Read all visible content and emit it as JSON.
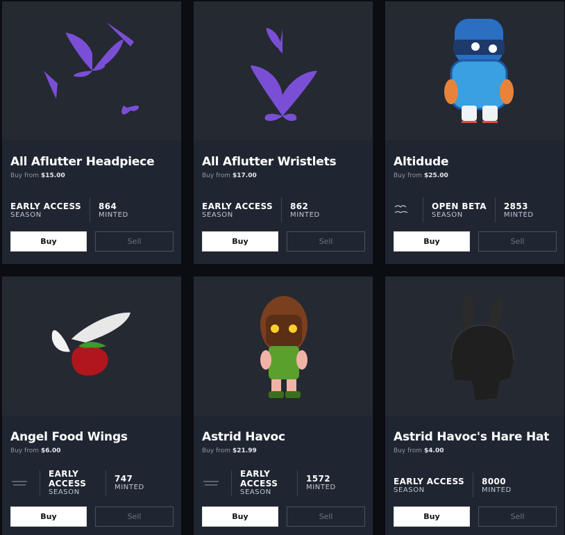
{
  "cards": [
    {
      "title": "All Aflutter Headpiece",
      "price_label": "Buy from",
      "price": "$15.00",
      "season_value": "EARLY ACCESS",
      "season_label": "SEASON",
      "minted_value": "864",
      "minted_label": "MINTED",
      "buy": "Buy",
      "sell": "Sell",
      "brand": null
    },
    {
      "title": "All Aflutter Wristlets",
      "price_label": "Buy from",
      "price": "$17.00",
      "season_value": "EARLY ACCESS",
      "season_label": "SEASON",
      "minted_value": "862",
      "minted_label": "MINTED",
      "buy": "Buy",
      "sell": "Sell",
      "brand": null
    },
    {
      "title": "Altidude",
      "price_label": "Buy from",
      "price": "$25.00",
      "season_value": "OPEN BETA",
      "season_label": "SEASON",
      "minted_value": "2853",
      "minted_label": "MINTED",
      "buy": "Buy",
      "sell": "Sell",
      "brand": "brand-logo"
    },
    {
      "title": "Angel Food Wings",
      "price_label": "Buy from",
      "price": "$6.00",
      "season_value": "EARLY ACCESS",
      "season_label": "SEASON",
      "minted_value": "747",
      "minted_label": "MINTED",
      "buy": "Buy",
      "sell": "Sell",
      "brand": "brand-logo"
    },
    {
      "title": "Astrid Havoc",
      "price_label": "Buy from",
      "price": "$21.99",
      "season_value": "EARLY ACCESS",
      "season_label": "SEASON",
      "minted_value": "1572",
      "minted_label": "MINTED",
      "buy": "Buy",
      "sell": "Sell",
      "brand": "brand-logo"
    },
    {
      "title": "Astrid Havoc's Hare Hat",
      "price_label": "Buy from",
      "price": "$4.00",
      "season_value": "EARLY ACCESS",
      "season_label": "SEASON",
      "minted_value": "8000",
      "minted_label": "MINTED",
      "buy": "Buy",
      "sell": "Sell",
      "brand": null
    }
  ],
  "colors": {
    "card_bg": "#1f2631",
    "image_bg": "#252932",
    "accent_purple": "#7a4fd6",
    "page_bg": "#0b0d12"
  }
}
